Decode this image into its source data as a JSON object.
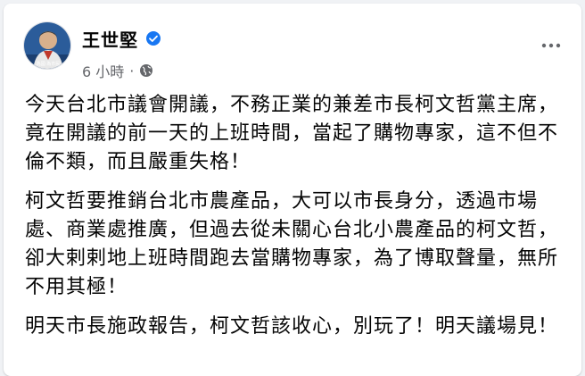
{
  "post": {
    "author": "王世堅",
    "verified_icon": "verified-badge-icon",
    "timestamp": "6 小時",
    "separator": "·",
    "audience_icon": "globe-icon",
    "more_icon": "more-horizontal-icon",
    "avatar_caption": "為國·為市民",
    "paragraphs": [
      "今天台北市議會開議，不務正業的兼差市長柯文哲黨主席，竟在開議的前一天的上班時間，當起了購物專家，這不但不倫不類，而且嚴重失格！",
      "柯文哲要推銷台北市農產品，大可以市長身分，透過市場處、商業處推廣，但過去從未關心台北小農產品的柯文哲，卻大剌剌地上班時間跑去當購物專家，為了博取聲量，無所不用其極！",
      "明天市長施政報告，柯文哲該收心，別玩了！明天議場見！"
    ]
  },
  "colors": {
    "verified_blue": "#1877f2",
    "text_primary": "#050505",
    "text_secondary": "#65676b",
    "page_bg": "#f0f2f5"
  }
}
